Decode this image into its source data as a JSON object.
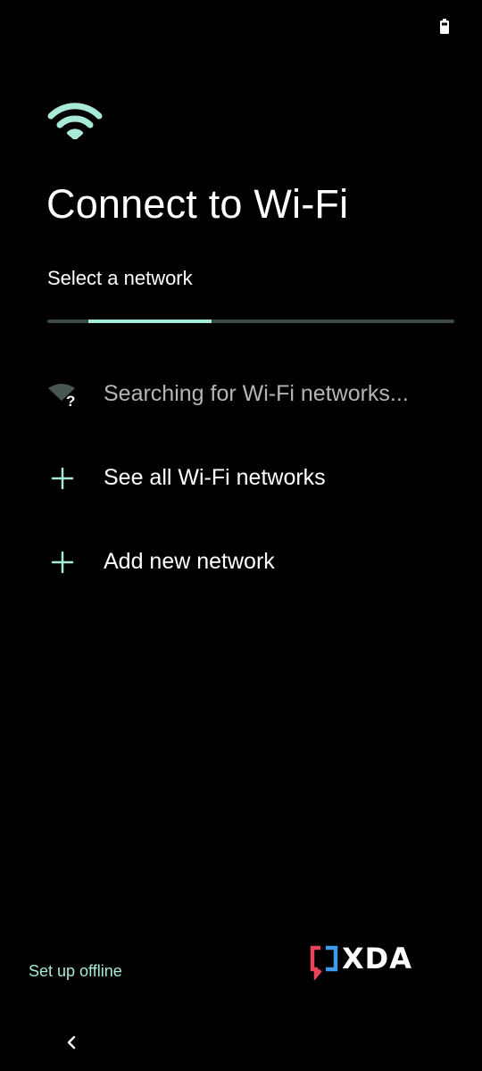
{
  "status_bar": {
    "battery_icon": "battery-icon"
  },
  "header": {
    "icon": "wifi-icon",
    "title": "Connect to Wi-Fi",
    "subtitle": "Select a network",
    "progress_indicator": "indeterminate"
  },
  "network_list": {
    "items": [
      {
        "icon": "wifi-unknown-icon",
        "label": "Searching for Wi-Fi networks..."
      },
      {
        "icon": "plus-icon",
        "label": "See all Wi-Fi networks"
      },
      {
        "icon": "plus-icon",
        "label": "Add new network"
      }
    ]
  },
  "footer": {
    "offline_label": "Set up offline",
    "watermark_text": "XDA",
    "back_icon": "chevron-left-icon"
  },
  "colors": {
    "background": "#000000",
    "accent": "#a8ead8",
    "text_primary": "#ffffff",
    "text_secondary": "#b5b5b5",
    "track": "#3d4a47"
  }
}
